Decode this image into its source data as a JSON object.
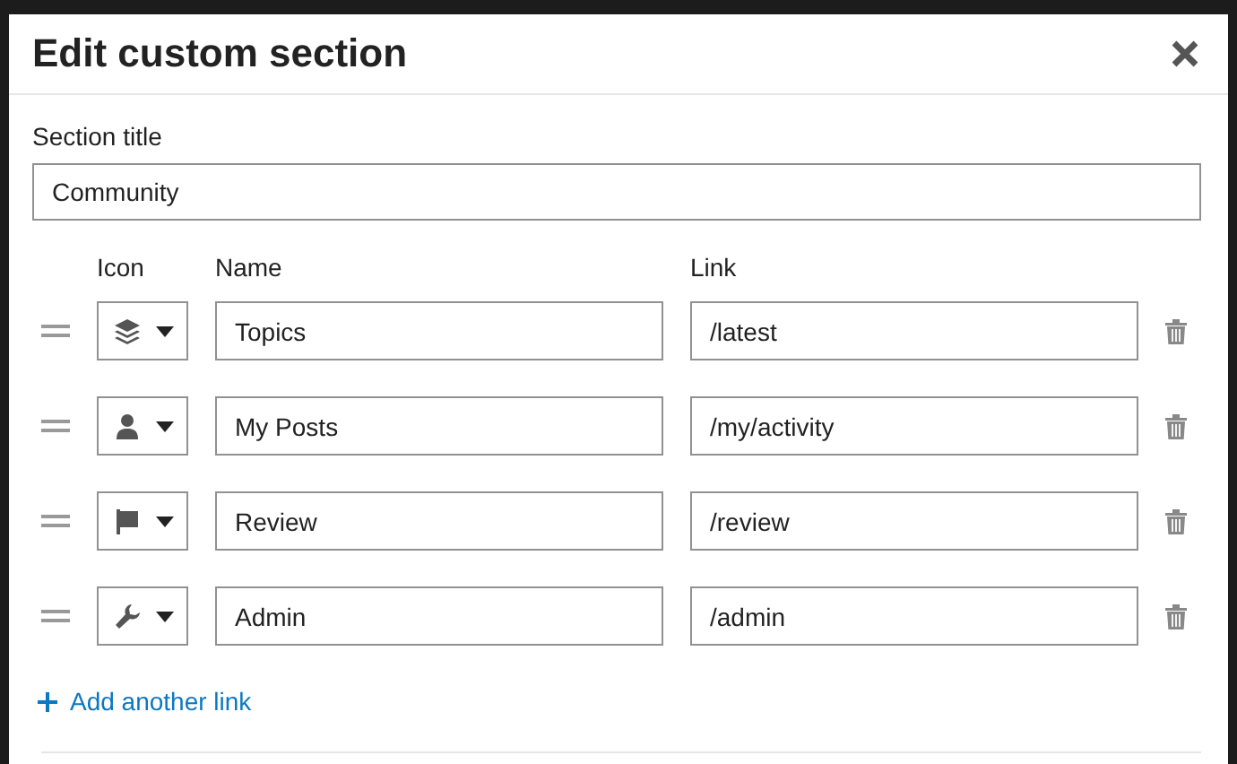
{
  "dialog": {
    "title": "Edit custom section"
  },
  "section_title": {
    "label": "Section title",
    "value": "Community"
  },
  "columns": {
    "icon": "Icon",
    "name": "Name",
    "link": "Link"
  },
  "links": [
    {
      "kind": "layers",
      "name": "Topics",
      "link": "/latest"
    },
    {
      "kind": "user",
      "name": "My Posts",
      "link": "/my/activity"
    },
    {
      "kind": "flag",
      "name": "Review",
      "link": "/review"
    },
    {
      "kind": "wrench",
      "name": "Admin",
      "link": "/admin"
    }
  ],
  "add_link": "Add another link"
}
